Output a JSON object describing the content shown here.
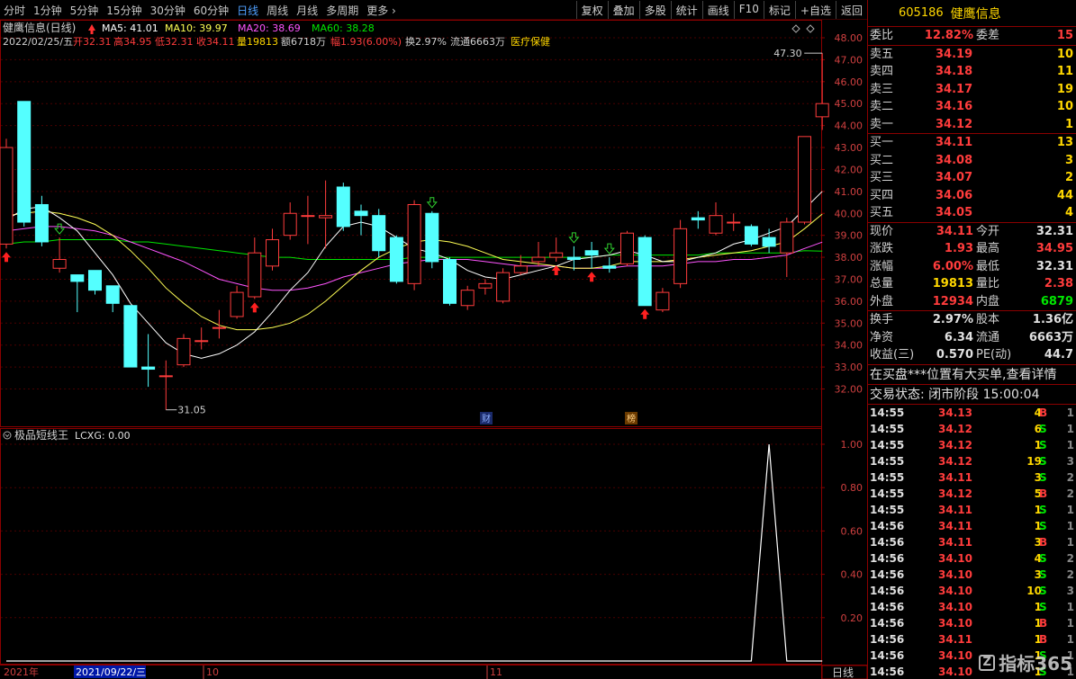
{
  "toolbar": {
    "periods": [
      "分时",
      "1分钟",
      "5分钟",
      "15分钟",
      "30分钟",
      "60分钟",
      "日线",
      "周线",
      "月线",
      "多周期",
      "更多 ›"
    ],
    "active_period": "日线",
    "tools": [
      "复权",
      "叠加",
      "多股",
      "统计",
      "画线",
      "F10",
      "标记",
      "+自选",
      "返回"
    ]
  },
  "chart_header": {
    "title": "健鹰信息(日线)",
    "ma5": "MA5: 41.01",
    "ma10": "MA10: 39.97",
    "ma20": "MA20: 38.69",
    "ma60": "MA60: 38.28",
    "ohlc_line": "2022/02/25/五 开32.31 高34.95 低32.31 收34.11 量19813 额6718万 幅1.93(6.00%) 换2.97% 流通6663万 医疗保健",
    "date": "2022/02/25/五",
    "open": "开32.31",
    "high": "高34.95",
    "low": "低32.31",
    "close": "收34.11",
    "vol": "量19813",
    "amount": "额6718万",
    "change": "幅1.93(6.00%)",
    "turnover": "换2.97%",
    "float": "流通6663万",
    "industry": "医疗保健"
  },
  "indicator": {
    "title": "极品短线王",
    "value_label": "LCXG: 0.00"
  },
  "axis": {
    "price_ticks": [
      "48.00",
      "47.00",
      "46.00",
      "45.00",
      "44.00",
      "43.00",
      "42.00",
      "41.00",
      "40.00",
      "39.00",
      "38.00",
      "37.00",
      "36.00",
      "35.00",
      "34.00",
      "33.00",
      "32.00"
    ],
    "ind_ticks": [
      "1.00",
      "0.80",
      "0.60",
      "0.40",
      "0.20"
    ],
    "time_labels": [
      "2021年",
      "2021/09/22/三",
      "10",
      "11"
    ],
    "period_label": "日线",
    "max_label": "47.30",
    "min_label": "31.05",
    "marker_fin": "财",
    "marker_rank": "榜"
  },
  "colors": {
    "up": "#ff3c3c",
    "down": "#54ffff",
    "ma5": "#ffffff",
    "ma10": "#ffff55",
    "ma20": "#ff55ff",
    "ma60": "#00e600",
    "grid": "#4a0000"
  },
  "chart_data": {
    "type": "candlestick",
    "title": "健鹰信息(日线)",
    "ylim": [
      31.5,
      48.3
    ],
    "candles": [
      {
        "o": 38.6,
        "c": 43.0,
        "h": 43.4,
        "l": 38.4
      },
      {
        "o": 45.1,
        "c": 39.6,
        "h": 45.1,
        "l": 39.4
      },
      {
        "o": 40.4,
        "c": 38.7,
        "h": 40.8,
        "l": 38.5
      },
      {
        "o": 37.5,
        "c": 37.9,
        "h": 38.9,
        "l": 37.3
      },
      {
        "o": 37.2,
        "c": 36.9,
        "h": 37.2,
        "l": 35.5
      },
      {
        "o": 37.4,
        "c": 36.5,
        "h": 37.4,
        "l": 36.3
      },
      {
        "o": 36.7,
        "c": 35.9,
        "h": 36.7,
        "l": 35.5
      },
      {
        "o": 35.8,
        "c": 33.0,
        "h": 35.8,
        "l": 33.0
      },
      {
        "o": 33.0,
        "c": 32.9,
        "h": 34.5,
        "l": 32.1
      },
      {
        "o": 32.6,
        "c": 32.6,
        "h": 33.3,
        "l": 31.05
      },
      {
        "o": 33.1,
        "c": 34.3,
        "h": 34.5,
        "l": 33.0
      },
      {
        "o": 34.2,
        "c": 34.2,
        "h": 34.8,
        "l": 33.8
      },
      {
        "o": 34.8,
        "c": 34.8,
        "h": 35.6,
        "l": 34.3
      },
      {
        "o": 35.3,
        "c": 36.4,
        "h": 36.7,
        "l": 35.2
      },
      {
        "o": 36.2,
        "c": 38.2,
        "h": 38.9,
        "l": 36.1
      },
      {
        "o": 37.6,
        "c": 38.8,
        "h": 39.3,
        "l": 37.4
      },
      {
        "o": 39.0,
        "c": 40.0,
        "h": 40.5,
        "l": 38.8
      },
      {
        "o": 39.9,
        "c": 39.9,
        "h": 40.8,
        "l": 38.6
      },
      {
        "o": 39.8,
        "c": 39.9,
        "h": 41.5,
        "l": 38.4
      },
      {
        "o": 41.2,
        "c": 39.4,
        "h": 41.4,
        "l": 39.2
      },
      {
        "o": 40.1,
        "c": 39.9,
        "h": 40.4,
        "l": 39.0
      },
      {
        "o": 39.9,
        "c": 38.3,
        "h": 40.2,
        "l": 38.0
      },
      {
        "o": 38.9,
        "c": 36.9,
        "h": 39.0,
        "l": 36.8
      },
      {
        "o": 36.8,
        "c": 40.4,
        "h": 40.6,
        "l": 36.5
      },
      {
        "o": 40.0,
        "c": 37.8,
        "h": 40.1,
        "l": 37.5
      },
      {
        "o": 37.9,
        "c": 35.9,
        "h": 38.0,
        "l": 35.8
      },
      {
        "o": 35.8,
        "c": 36.5,
        "h": 36.7,
        "l": 35.6
      },
      {
        "o": 36.6,
        "c": 36.8,
        "h": 37.0,
        "l": 36.3
      },
      {
        "o": 36.0,
        "c": 37.3,
        "h": 37.5,
        "l": 35.9
      },
      {
        "o": 37.3,
        "c": 37.6,
        "h": 38.1,
        "l": 37.2
      },
      {
        "o": 37.8,
        "c": 38.0,
        "h": 38.7,
        "l": 37.6
      },
      {
        "o": 38.0,
        "c": 38.2,
        "h": 38.9,
        "l": 37.8
      },
      {
        "o": 38.0,
        "c": 37.9,
        "h": 38.5,
        "l": 37.4
      },
      {
        "o": 38.3,
        "c": 38.1,
        "h": 38.7,
        "l": 37.5
      },
      {
        "o": 37.6,
        "c": 37.5,
        "h": 38.0,
        "l": 37.3
      },
      {
        "o": 37.7,
        "c": 39.1,
        "h": 39.2,
        "l": 37.6
      },
      {
        "o": 38.9,
        "c": 35.8,
        "h": 39.0,
        "l": 35.8
      },
      {
        "o": 35.6,
        "c": 36.4,
        "h": 36.6,
        "l": 35.5
      },
      {
        "o": 36.8,
        "c": 39.3,
        "h": 39.7,
        "l": 36.6
      },
      {
        "o": 39.8,
        "c": 39.7,
        "h": 40.1,
        "l": 39.3
      },
      {
        "o": 39.1,
        "c": 39.9,
        "h": 40.5,
        "l": 39.0
      },
      {
        "o": 39.6,
        "c": 39.6,
        "h": 40.0,
        "l": 39.2
      },
      {
        "o": 39.4,
        "c": 38.6,
        "h": 39.5,
        "l": 38.5
      },
      {
        "o": 38.9,
        "c": 38.5,
        "h": 39.3,
        "l": 38.2
      },
      {
        "o": 38.2,
        "c": 39.6,
        "h": 39.8,
        "l": 37.1
      },
      {
        "o": 39.6,
        "c": 43.5,
        "h": 43.5,
        "l": 39.5
      },
      {
        "o": 44.4,
        "c": 45.0,
        "h": 47.3,
        "l": 43.8
      }
    ],
    "ma5": [
      39.7,
      40.2,
      40.3,
      39.8,
      39.2,
      38.2,
      37.2,
      35.9,
      35.0,
      34.1,
      33.6,
      33.4,
      33.6,
      34.0,
      34.6,
      35.5,
      36.5,
      37.3,
      38.5,
      39.4,
      39.6,
      39.4,
      38.9,
      38.4,
      38.2,
      37.9,
      37.4,
      37.1,
      37.0,
      37.2,
      37.4,
      37.6,
      37.9,
      38.0,
      38.1,
      38.3,
      38.1,
      37.8,
      37.8,
      38.0,
      38.2,
      38.6,
      38.8,
      39.1,
      39.4,
      40.2,
      41.0
    ],
    "ma10": [
      39.9,
      40.0,
      40.1,
      40.0,
      39.8,
      39.5,
      39.0,
      38.3,
      37.5,
      36.6,
      35.9,
      35.3,
      34.9,
      34.7,
      34.7,
      34.8,
      35.0,
      35.4,
      36.0,
      36.7,
      37.4,
      38.0,
      38.4,
      38.7,
      38.8,
      38.7,
      38.5,
      38.2,
      37.9,
      37.8,
      37.7,
      37.6,
      37.5,
      37.5,
      37.6,
      37.8,
      37.8,
      37.8,
      37.9,
      38.0,
      38.1,
      38.2,
      38.3,
      38.5,
      38.7,
      39.3,
      39.97
    ],
    "ma20": [
      39.2,
      39.3,
      39.4,
      39.4,
      39.3,
      39.2,
      39.0,
      38.7,
      38.4,
      38.1,
      37.8,
      37.4,
      37.0,
      36.8,
      36.6,
      36.5,
      36.5,
      36.6,
      36.8,
      37.1,
      37.3,
      37.5,
      37.7,
      37.8,
      37.9,
      37.9,
      37.9,
      37.8,
      37.7,
      37.6,
      37.6,
      37.6,
      37.5,
      37.5,
      37.5,
      37.6,
      37.6,
      37.6,
      37.7,
      37.8,
      37.8,
      37.9,
      37.9,
      38.0,
      38.1,
      38.4,
      38.69
    ],
    "ma60": [
      38.6,
      38.7,
      38.7,
      38.8,
      38.8,
      38.8,
      38.8,
      38.7,
      38.7,
      38.6,
      38.5,
      38.4,
      38.3,
      38.2,
      38.1,
      38.0,
      38.0,
      37.9,
      37.9,
      37.9,
      37.9,
      37.9,
      37.9,
      38.0,
      38.0,
      38.0,
      38.0,
      38.0,
      38.0,
      38.0,
      38.0,
      38.0,
      38.0,
      38.0,
      38.1,
      38.1,
      38.1,
      38.1,
      38.1,
      38.1,
      38.2,
      38.2,
      38.2,
      38.2,
      38.2,
      38.3,
      38.28
    ],
    "up_arrows": [
      0,
      14,
      31,
      33,
      36
    ],
    "down_arrows": [
      3,
      24,
      32,
      34
    ],
    "indicator": {
      "name": "LCXG",
      "ylim": [
        0,
        1.1
      ],
      "values": [
        0,
        0,
        0,
        0,
        0,
        0,
        0,
        0,
        0,
        0,
        0,
        0,
        0,
        0,
        0,
        0,
        0,
        0,
        0,
        0,
        0,
        0,
        0,
        0,
        0,
        0,
        0,
        0,
        0,
        0,
        0,
        0,
        0,
        0,
        0,
        0,
        0,
        0,
        0,
        0,
        0,
        0,
        0,
        1,
        0,
        0,
        0
      ]
    }
  },
  "quote": {
    "code": "605186",
    "name": "健鹰信息",
    "weibi_label": "委比",
    "weibi_value": "12.82%",
    "weicha_label": "委差",
    "weicha_value": "15",
    "asks": [
      {
        "label": "卖五",
        "price": "34.19",
        "vol": "10"
      },
      {
        "label": "卖四",
        "price": "34.18",
        "vol": "11"
      },
      {
        "label": "卖三",
        "price": "34.17",
        "vol": "19"
      },
      {
        "label": "卖二",
        "price": "34.16",
        "vol": "10"
      },
      {
        "label": "卖一",
        "price": "34.12",
        "vol": "1"
      }
    ],
    "bids": [
      {
        "label": "买一",
        "price": "34.11",
        "vol": "13"
      },
      {
        "label": "买二",
        "price": "34.08",
        "vol": "3"
      },
      {
        "label": "买三",
        "price": "34.07",
        "vol": "2"
      },
      {
        "label": "买四",
        "price": "34.06",
        "vol": "44"
      },
      {
        "label": "买五",
        "price": "34.05",
        "vol": "4"
      }
    ],
    "stats1": [
      {
        "l1": "现价",
        "v1": "34.11",
        "c1": "red",
        "l2": "今开",
        "v2": "32.31",
        "c2": "white"
      },
      {
        "l1": "涨跌",
        "v1": "1.93",
        "c1": "red",
        "l2": "最高",
        "v2": "34.95",
        "c2": "red"
      },
      {
        "l1": "涨幅",
        "v1": "6.00%",
        "c1": "red",
        "l2": "最低",
        "v2": "32.31",
        "c2": "white"
      },
      {
        "l1": "总量",
        "v1": "19813",
        "c1": "yellow",
        "l2": "量比",
        "v2": "2.38",
        "c2": "red"
      },
      {
        "l1": "外盘",
        "v1": "12934",
        "c1": "red",
        "l2": "内盘",
        "v2": "6879",
        "c2": "green"
      }
    ],
    "stats2": [
      {
        "l1": "换手",
        "v1": "2.97%",
        "c1": "white",
        "l2": "股本",
        "v2": "1.36亿",
        "c2": "white"
      },
      {
        "l1": "净资",
        "v1": "6.34",
        "c1": "white",
        "l2": "流通",
        "v2": "6663万",
        "c2": "white"
      },
      {
        "l1": "收益(三)",
        "v1": "0.570",
        "c1": "white",
        "l2": "PE(动)",
        "v2": "44.7",
        "c2": "white"
      }
    ],
    "notice": "在买盘***位置有大买单,查看详情",
    "status": "交易状态: 闭市阶段 15:00:04",
    "ticks": [
      {
        "t": "14:55",
        "p": "34.13",
        "pc": "red",
        "v": "4",
        "d": "B",
        "dc": "red",
        "e": "1"
      },
      {
        "t": "14:55",
        "p": "34.12",
        "pc": "red",
        "v": "6",
        "d": "S",
        "dc": "green",
        "e": "1"
      },
      {
        "t": "14:55",
        "p": "34.12",
        "pc": "red",
        "v": "1",
        "d": "S",
        "dc": "green",
        "e": "1"
      },
      {
        "t": "14:55",
        "p": "34.12",
        "pc": "red",
        "v": "19",
        "d": "S",
        "dc": "green",
        "e": "3"
      },
      {
        "t": "14:55",
        "p": "34.11",
        "pc": "red",
        "v": "3",
        "d": "S",
        "dc": "green",
        "e": "2"
      },
      {
        "t": "14:55",
        "p": "34.12",
        "pc": "red",
        "v": "5",
        "d": "B",
        "dc": "red",
        "e": "2"
      },
      {
        "t": "14:55",
        "p": "34.11",
        "pc": "red",
        "v": "1",
        "d": "S",
        "dc": "green",
        "e": "1"
      },
      {
        "t": "14:56",
        "p": "34.11",
        "pc": "red",
        "v": "1",
        "d": "S",
        "dc": "green",
        "e": "1"
      },
      {
        "t": "14:56",
        "p": "34.11",
        "pc": "red",
        "v": "3",
        "d": "B",
        "dc": "red",
        "e": "1"
      },
      {
        "t": "14:56",
        "p": "34.10",
        "pc": "red",
        "v": "4",
        "d": "S",
        "dc": "green",
        "e": "2"
      },
      {
        "t": "14:56",
        "p": "34.10",
        "pc": "red",
        "v": "3",
        "d": "S",
        "dc": "green",
        "e": "2"
      },
      {
        "t": "14:56",
        "p": "34.10",
        "pc": "red",
        "v": "10",
        "d": "S",
        "dc": "green",
        "e": "3"
      },
      {
        "t": "14:56",
        "p": "34.10",
        "pc": "red",
        "v": "1",
        "d": "S",
        "dc": "green",
        "e": "1"
      },
      {
        "t": "14:56",
        "p": "34.10",
        "pc": "red",
        "v": "1",
        "d": "B",
        "dc": "red",
        "e": "1"
      },
      {
        "t": "14:56",
        "p": "34.11",
        "pc": "red",
        "v": "1",
        "d": "B",
        "dc": "red",
        "e": "1"
      },
      {
        "t": "14:56",
        "p": "34.10",
        "pc": "red",
        "v": "1",
        "d": "S",
        "dc": "green",
        "e": "1"
      },
      {
        "t": "14:56",
        "p": "34.10",
        "pc": "red",
        "v": "1",
        "d": "S",
        "dc": "green",
        "e": "1"
      }
    ]
  },
  "watermark": {
    "text": "指标365",
    "glyph": "Z"
  }
}
